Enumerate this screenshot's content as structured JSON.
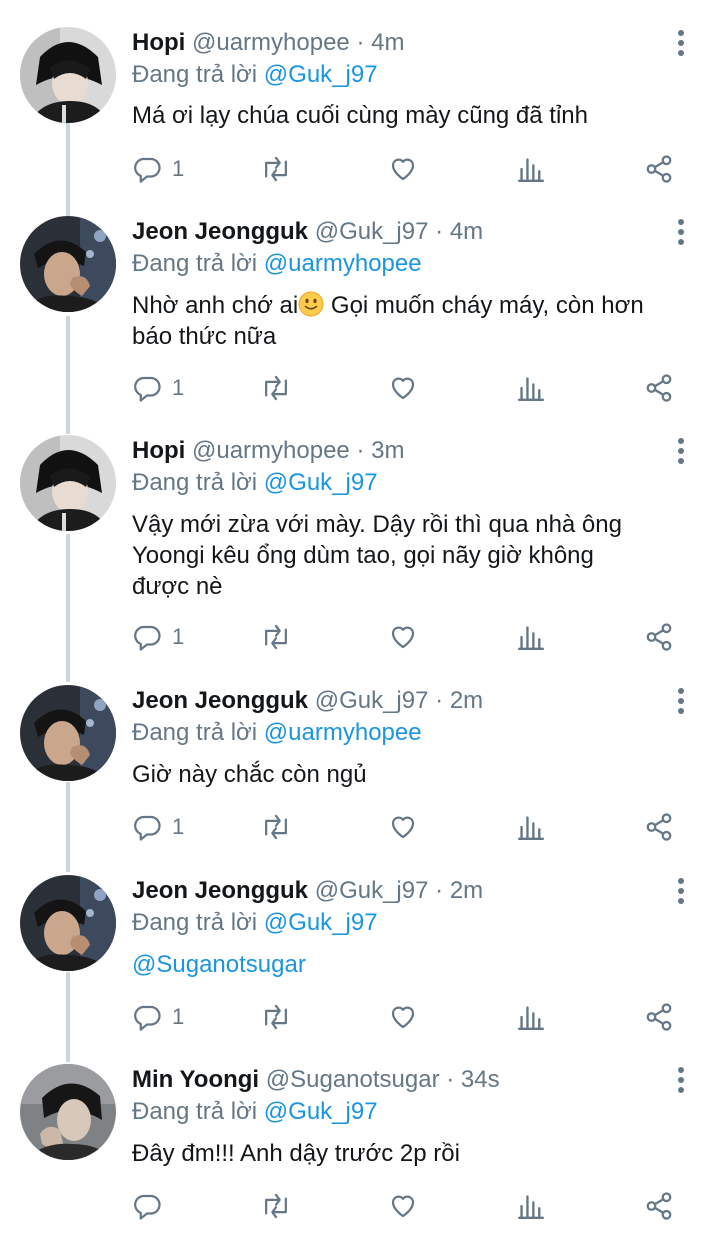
{
  "tweets": [
    {
      "name": "Hopi",
      "handle": "@uarmyhopee",
      "time": "4m",
      "reply_prefix": "Đang trả lời",
      "reply_to": "@Guk_j97",
      "body_lines": [
        "Má ơi lạy chúa cuối cùng mày cũng đã tỉnh"
      ],
      "reply_count": "1",
      "avatar": "hopi"
    },
    {
      "name": "Jeon Jeongguk",
      "handle": "@Guk_j97",
      "time": "4m",
      "reply_prefix": "Đang trả lời",
      "reply_to": "@uarmyhopee",
      "body_before_emoji": "Nhờ anh chớ ai",
      "body_after_emoji": " Gọi muốn cháy máy, còn hơn",
      "body_line2": "báo thức nữa",
      "reply_count": "1",
      "avatar": "jk"
    },
    {
      "name": "Hopi",
      "handle": "@uarmyhopee",
      "time": "3m",
      "reply_prefix": "Đang trả lời",
      "reply_to": "@Guk_j97",
      "body_lines": [
        "Vậy mới zừa với mày. Dậy rồi thì qua nhà ông",
        "Yoongi kêu ổng dùm tao, gọi nãy giờ không",
        "được nè"
      ],
      "reply_count": "1",
      "avatar": "hopi"
    },
    {
      "name": "Jeon Jeongguk",
      "handle": "@Guk_j97",
      "time": "2m",
      "reply_prefix": "Đang trả lời",
      "reply_to": "@uarmyhopee",
      "body_lines": [
        "Giờ này chắc còn ngủ"
      ],
      "reply_count": "1",
      "avatar": "jk"
    },
    {
      "name": "Jeon Jeongguk",
      "handle": "@Guk_j97",
      "time": "2m",
      "reply_prefix": "Đang trả lời",
      "reply_to": "@Guk_j97",
      "body_link": "@Suganotsugar",
      "reply_count": "1",
      "avatar": "jk"
    },
    {
      "name": "Min Yoongi",
      "handle": "@Suganotsugar",
      "time": "34s",
      "reply_prefix": "Đang trả lời",
      "reply_to": "@Guk_j97",
      "body_lines": [
        "Đây đm!!! Anh dậy trước 2p rồi"
      ],
      "reply_count": "",
      "avatar": "yoongi"
    }
  ],
  "separator": "·",
  "icons": {
    "more": "more-vertical-icon",
    "reply": "reply-icon",
    "retweet": "retweet-icon",
    "like": "heart-icon",
    "analytics": "analytics-icon",
    "share": "share-icon",
    "emoji": "slightly-smiling-face-emoji"
  },
  "colors": {
    "link": "#1b95e0",
    "secondary_text": "#657786",
    "primary_text": "#14171a",
    "thread_line": "#ccd6dd"
  }
}
